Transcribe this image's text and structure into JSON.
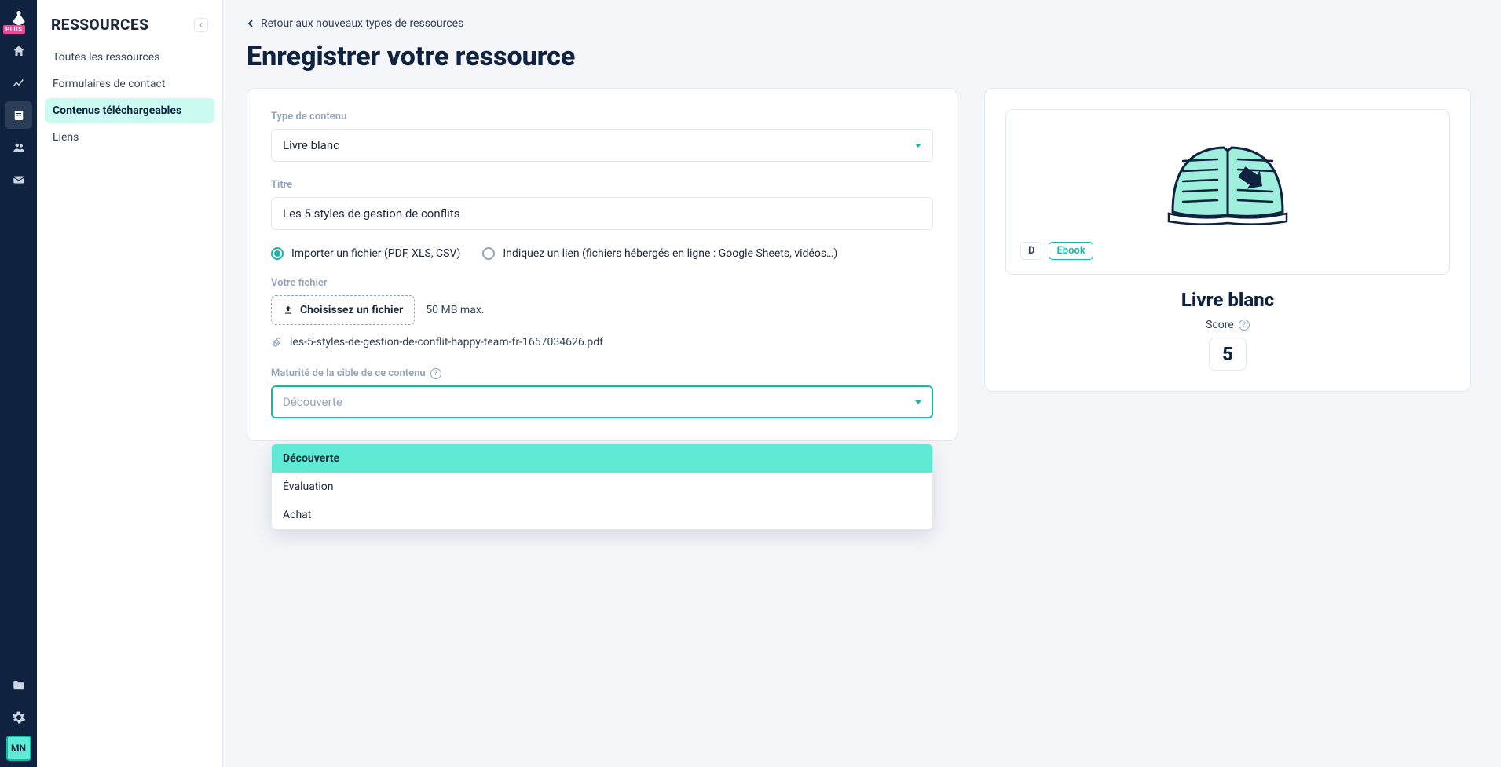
{
  "rail": {
    "plus_badge": "PLUS",
    "avatar_initials": "MN"
  },
  "sidebar": {
    "title": "RESSOURCES",
    "items": [
      {
        "label": "Toutes les ressources"
      },
      {
        "label": "Formulaires de contact"
      },
      {
        "label": "Contenus téléchargeables"
      },
      {
        "label": "Liens"
      }
    ]
  },
  "page": {
    "back_label": "Retour aux nouveaux types de ressources",
    "title": "Enregistrer votre ressource"
  },
  "form": {
    "content_type_label": "Type de contenu",
    "content_type_value": "Livre blanc",
    "title_label": "Titre",
    "title_value": "Les 5 styles de gestion de conflits",
    "import_radio": {
      "option_file": "Importer un fichier (PDF, XLS, CSV)",
      "option_link": "Indiquez un lien (fichiers hébergés en ligne : Google Sheets, vidéos…)"
    },
    "file_label": "Votre fichier",
    "file_button": "Choisissez un fichier",
    "file_max": "50 MB max.",
    "attached_file": "les-5-styles-de-gestion-de-conflit-happy-team-fr-1657034626.pdf",
    "maturity_label": "Maturité de la cible de ce contenu",
    "maturity_placeholder": "Découverte",
    "maturity_options": [
      "Découverte",
      "Évaluation",
      "Achat"
    ]
  },
  "preview": {
    "badge_letter": "D",
    "badge_tag": "Ebook",
    "title": "Livre blanc",
    "score_label": "Score",
    "score_value": "5"
  }
}
